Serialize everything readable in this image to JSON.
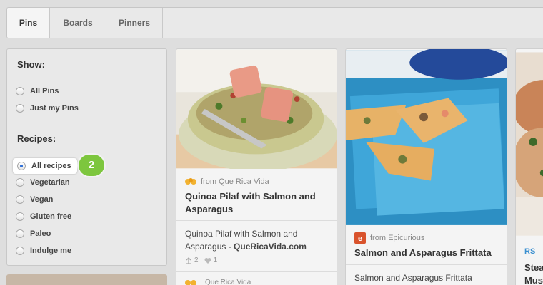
{
  "tabs": [
    {
      "label": "Pins",
      "active": true
    },
    {
      "label": "Boards",
      "active": false
    },
    {
      "label": "Pinners",
      "active": false
    }
  ],
  "filter": {
    "show_title": "Show:",
    "show_options": [
      "All Pins",
      "Just my Pins"
    ],
    "recipes_title": "Recipes:",
    "recipe_options": [
      "All recipes",
      "Vegetarian",
      "Vegan",
      "Gluten free",
      "Paleo",
      "Indulge me"
    ],
    "selected_recipe": "All recipes",
    "step_badge": "2"
  },
  "cards": [
    {
      "source_prefix": "from",
      "source": "Que Rica Vida",
      "source_icon": "que-rica-vida-logo-icon",
      "title": "Quinoa Pilaf with Salmon and Asparagus",
      "desc_text": "Quinoa Pilaf with Salmon and Asparagus - ",
      "desc_link": "QueRicaVida.com",
      "repins": "2",
      "likes": "1",
      "next_source": "Que Rica Vida"
    },
    {
      "source_prefix": "from",
      "source": "Epicurious",
      "source_icon": "epicurious-logo-icon",
      "title": "Salmon and Asparagus Frittata",
      "desc_text": "Salmon and Asparagus Frittata"
    },
    {
      "source_prefix": "RS",
      "title_partial": "Stea",
      "title_partial_2": "Mus"
    }
  ],
  "colors": {
    "badge": "#7dc63e",
    "radio_selected": "#2e6fd6",
    "epicurious": "#d9532c",
    "que_rica_vida": "#f2b230"
  }
}
